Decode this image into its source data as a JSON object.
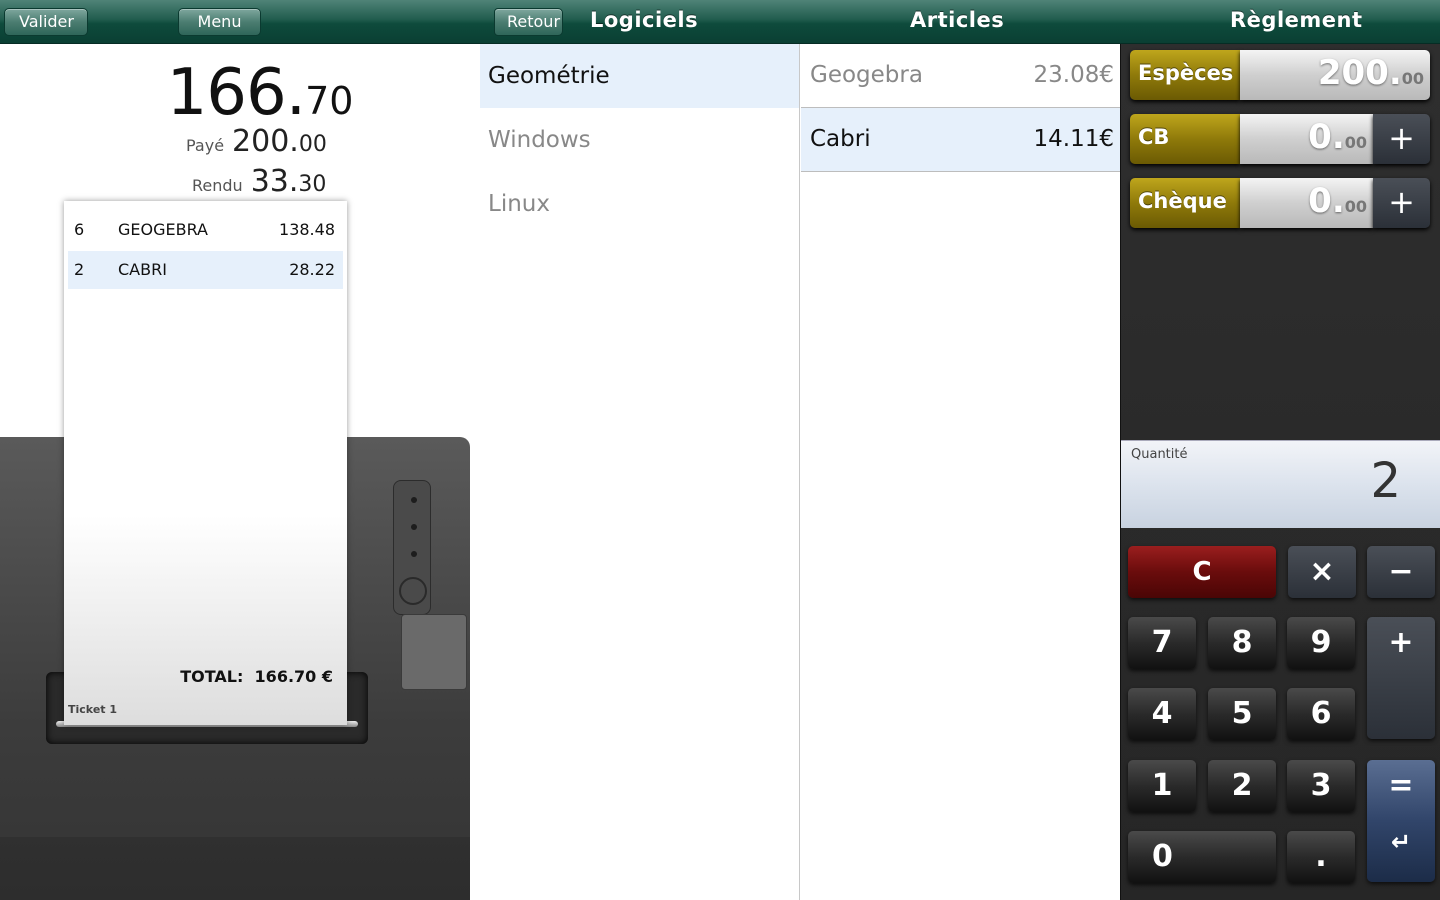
{
  "topbar": {
    "valider": "Valider",
    "menu": "Menu",
    "retour": "Retour",
    "logiciels": "Logiciels",
    "articles": "Articles",
    "reglement": "Règlement"
  },
  "summary": {
    "total_int": "166.",
    "total_dec": "70",
    "paye_label": "Payé",
    "paye_int": "200.",
    "paye_dec": "00",
    "rendu_label": "Rendu",
    "rendu_int": "33.",
    "rendu_dec": "30"
  },
  "ticket": {
    "lines": [
      {
        "qty": "6",
        "name": "GEOGEBRA",
        "price": "138.48"
      },
      {
        "qty": "2",
        "name": "CABRI",
        "price": "28.22"
      }
    ],
    "total_label": "TOTAL:",
    "total_value": "166.70 €",
    "name": "Ticket 1"
  },
  "categories": [
    "Geométrie",
    "Windows",
    "Linux"
  ],
  "articles": [
    {
      "name": "Geogebra",
      "price": "23.08€"
    },
    {
      "name": "Cabri",
      "price": "14.11€"
    }
  ],
  "payments": [
    {
      "label": "Espèces",
      "int": "200.",
      "dec": "00",
      "has_plus": false
    },
    {
      "label": "CB",
      "int": "0.",
      "dec": "00",
      "has_plus": true
    },
    {
      "label": "Chèque",
      "int": "0.",
      "dec": "00",
      "has_plus": true
    }
  ],
  "quantity": {
    "label": "Quantité",
    "value": "2"
  },
  "keypad": {
    "clear": "C",
    "multiply": "×",
    "minus": "−",
    "plus": "+",
    "equals": "=",
    "enter": "↵",
    "dot": ".",
    "digits": [
      "0",
      "1",
      "2",
      "3",
      "4",
      "5",
      "6",
      "7",
      "8",
      "9"
    ]
  },
  "colors": {
    "accent": "#0e4b3c",
    "selection": "#e6f0fb",
    "payment_label": "#8f7a0a",
    "clear_key": "#6a0c0c"
  }
}
